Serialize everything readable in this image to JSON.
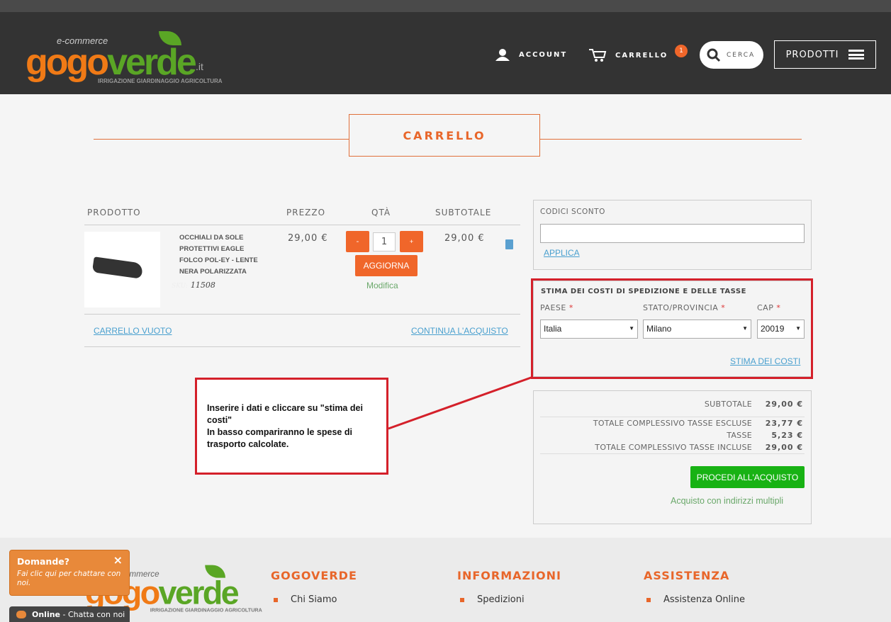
{
  "header": {
    "logo": {
      "top": "e-commerce",
      "main_a": "gogo",
      "main_b": "verde",
      ".it": ".it",
      "tagline": "IRRIGAZIONE GIARDINAGGIO AGRICOLTURA"
    },
    "account": "ACCOUNT",
    "cart": "CARRELLO",
    "cart_count": "1",
    "search": "CERCA",
    "products": "PRODOTTI"
  },
  "page": {
    "title": "CARRELLO"
  },
  "cart": {
    "headers": {
      "product": "PRODOTTO",
      "price": "PREZZO",
      "qty": "QTÀ",
      "subtotal": "SUBTOTALE"
    },
    "item": {
      "name": "OCCHIALI DA SOLE PROTETTIVI EAGLE FOLCO POL-EY - LENTE NERA POLARIZZATA",
      "sku_label": "SKU:",
      "sku": "11508",
      "price": "29,00 €",
      "qty": "1",
      "minus": "-",
      "plus": "+",
      "update": "AGGIORNA",
      "edit": "Modifica",
      "subtotal": "29,00 €"
    },
    "empty": "CARRELLO VUOTO",
    "continue": "CONTINUA L'ACQUISTO"
  },
  "discount": {
    "label": "CODICI SCONTO",
    "value": "",
    "apply": "APPLICA"
  },
  "shipping": {
    "title": "STIMA DEI COSTI DI SPEDIZIONE E DELLE TASSE",
    "country_label": "PAESE",
    "country": "Italia",
    "state_label": "STATO/PROVINCIA",
    "state": "Milano",
    "zip_label": "CAP",
    "zip": "20019",
    "estimate": "STIMA DEI COSTI",
    "required": "*"
  },
  "totals": {
    "rows": [
      {
        "label": "SUBTOTALE",
        "value": "29,00 €"
      },
      {
        "label": "TOTALE COMPLESSIVO TASSE ESCLUSE",
        "value": "23,77 €"
      },
      {
        "label": "TASSE",
        "value": "5,23 €"
      },
      {
        "label": "TOTALE COMPLESSIVO TASSE INCLUSE",
        "value": "29,00 €"
      }
    ],
    "checkout": "PROCEDI ALL'ACQUISTO",
    "multi": "Acquisto con indirizzi multipli"
  },
  "annotation": {
    "line1": "Inserire i dati e cliccare su \"stima dei costi\"",
    "line2": "In basso compariranno le spese di trasporto calcolate."
  },
  "footer": {
    "cols": [
      {
        "title": "GOGOVERDE",
        "item": "Chi Siamo"
      },
      {
        "title": "INFORMAZIONI",
        "item": "Spedizioni"
      },
      {
        "title": "ASSISTENZA",
        "item": "Assistenza Online"
      }
    ]
  },
  "chat": {
    "title": "Domande?",
    "close": "×",
    "text": "Fai clic qui per chattare con noi.",
    "status": "Online",
    "status_text": " - Chatta con noi"
  },
  "colors": {
    "accent": "#f0662a",
    "header_bg": "#333333",
    "checkout": "#18b214",
    "annotation": "#d4202a"
  }
}
